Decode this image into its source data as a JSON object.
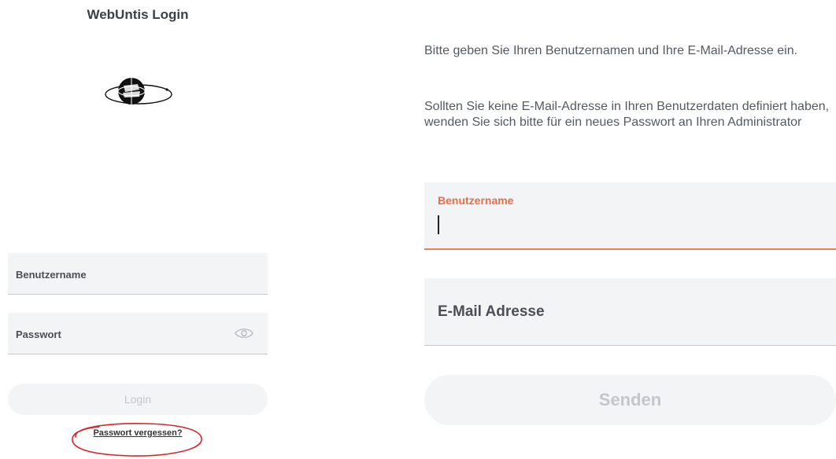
{
  "login_panel": {
    "title": "WebUntis Login",
    "logo_icon": "school-globe-logo",
    "username_label": "Benutzername",
    "password_label": "Passwort",
    "password_toggle_icon": "eye-icon",
    "login_button_label": "Login",
    "forgot_password_link": "Passwort vergessen?",
    "annotation_color": "#d9262a"
  },
  "reset_panel": {
    "instruction_1": "Bitte geben Sie Ihren Benutzernamen und Ihre E-Mail-Adresse ein.",
    "instruction_2": "Sollten Sie keine E-Mail-Adresse in Ihren Benutzerdaten definiert haben, wenden Sie sich bitte für ein neues Passwort an Ihren Administrator",
    "username_label": "Benutzername",
    "username_value": "",
    "email_label": "E-Mail Adresse",
    "send_button_label": "Senden",
    "focus_color": "#f06a46"
  }
}
